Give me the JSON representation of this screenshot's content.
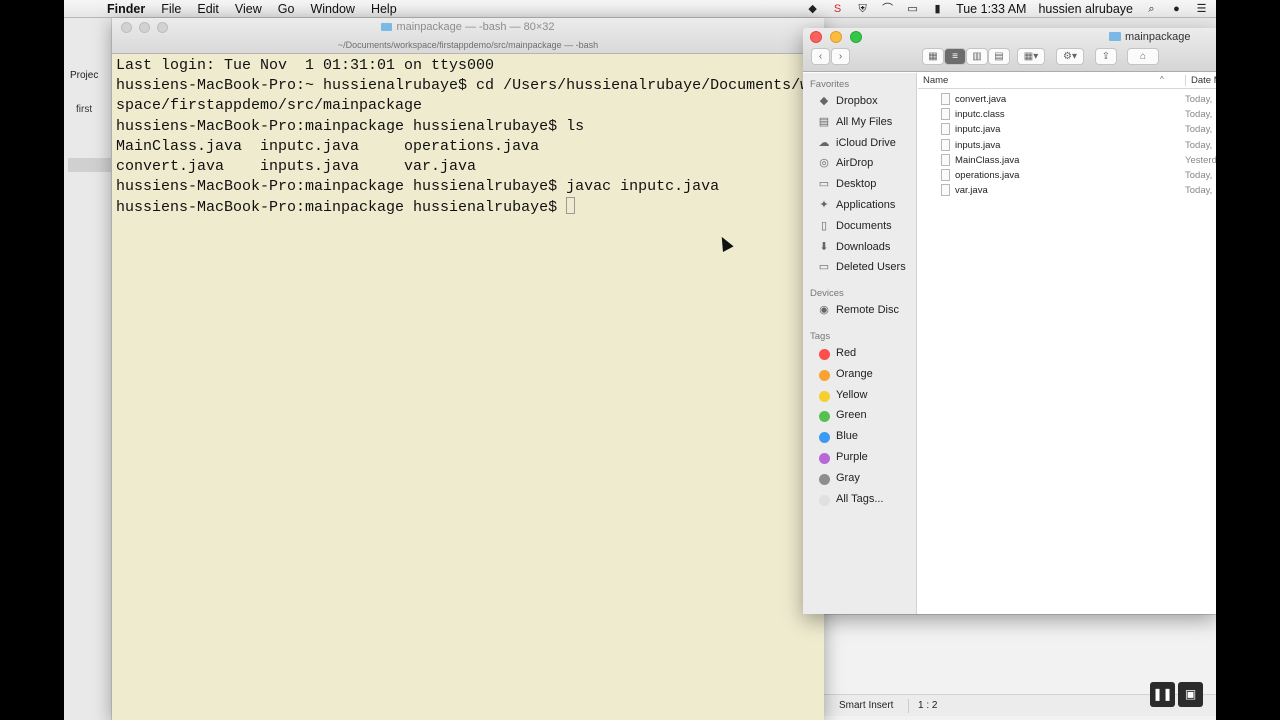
{
  "menubar": {
    "app": "Finder",
    "items": [
      "File",
      "Edit",
      "View",
      "Go",
      "Window",
      "Help"
    ],
    "clock": "Tue 1:33 AM",
    "user": "hussien alrubaye"
  },
  "eclipse": {
    "project_tab": "Projec",
    "tree_item": "first",
    "status_mode": "Smart Insert",
    "status_position": "1 : 2"
  },
  "terminal": {
    "title": "mainpackage — -bash — 80×32",
    "path": "~/Documents/workspace/firstappdemo/src/mainpackage — -bash",
    "lines": [
      "Last login: Tue Nov  1 01:31:01 on ttys000",
      "hussiens-MacBook-Pro:~ hussienalrubaye$ cd /Users/hussienalrubaye/Documents/wo",
      "space/firstappdemo/src/mainpackage",
      "hussiens-MacBook-Pro:mainpackage hussienalrubaye$ ls",
      "MainClass.java  inputc.java     operations.java",
      "convert.java    inputs.java     var.java",
      "hussiens-MacBook-Pro:mainpackage hussienalrubaye$ javac inputc.java",
      "hussiens-MacBook-Pro:mainpackage hussienalrubaye$ "
    ]
  },
  "finder": {
    "title": "mainpackage",
    "sidebar": {
      "favorites_heading": "Favorites",
      "favorites": [
        {
          "label": "Dropbox",
          "icon": "dropbox-icon"
        },
        {
          "label": "All My Files",
          "icon": "all-files-icon"
        },
        {
          "label": "iCloud Drive",
          "icon": "cloud-icon"
        },
        {
          "label": "AirDrop",
          "icon": "airdrop-icon"
        },
        {
          "label": "Desktop",
          "icon": "desktop-icon"
        },
        {
          "label": "Applications",
          "icon": "applications-icon"
        },
        {
          "label": "Documents",
          "icon": "documents-icon"
        },
        {
          "label": "Downloads",
          "icon": "downloads-icon"
        },
        {
          "label": "Deleted Users",
          "icon": "folder-icon"
        }
      ],
      "devices_heading": "Devices",
      "devices": [
        {
          "label": "Remote Disc",
          "icon": "disc-icon"
        }
      ],
      "tags_heading": "Tags",
      "tags": [
        {
          "label": "Red",
          "color": "#fc4f4b"
        },
        {
          "label": "Orange",
          "color": "#f9a133"
        },
        {
          "label": "Yellow",
          "color": "#f6cf2e"
        },
        {
          "label": "Green",
          "color": "#56c152"
        },
        {
          "label": "Blue",
          "color": "#3b9bf3"
        },
        {
          "label": "Purple",
          "color": "#b867d6"
        },
        {
          "label": "Gray",
          "color": "#8e8e8e"
        },
        {
          "label": "All Tags...",
          "color": "#e0e0e0"
        }
      ]
    },
    "columns": {
      "name": "Name",
      "date": "Date Mo"
    },
    "files": [
      {
        "name": "convert.java",
        "date": "Today,"
      },
      {
        "name": "inputc.class",
        "date": "Today,"
      },
      {
        "name": "inputc.java",
        "date": "Today,"
      },
      {
        "name": "inputs.java",
        "date": "Today,"
      },
      {
        "name": "MainClass.java",
        "date": "Yesterd"
      },
      {
        "name": "operations.java",
        "date": "Today,"
      },
      {
        "name": "var.java",
        "date": "Today,"
      }
    ]
  }
}
